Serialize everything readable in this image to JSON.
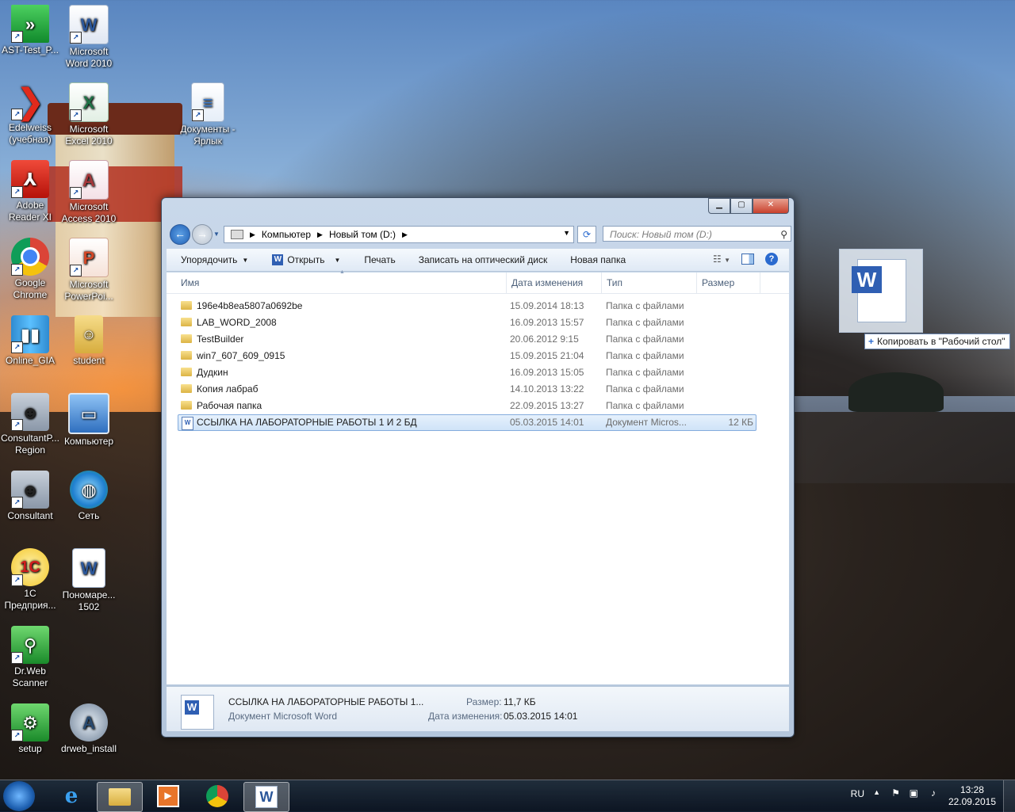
{
  "desktop_icons": [
    {
      "label": "AST-Test_P..."
    },
    {
      "label": "Microsoft Word 2010"
    },
    {
      "label": "Edelweiss (учебная)"
    },
    {
      "label": "Microsoft Excel 2010"
    },
    {
      "label": "Документы - Ярлык"
    },
    {
      "label": "Adobe Reader XI"
    },
    {
      "label": "Microsoft Access 2010"
    },
    {
      "label": "Google Chrome"
    },
    {
      "label": "Microsoft PowerPoi..."
    },
    {
      "label": "Online_GIA"
    },
    {
      "label": "student"
    },
    {
      "label": "ConsultantP... Region"
    },
    {
      "label": "Компьютер"
    },
    {
      "label": "Consultant"
    },
    {
      "label": "Сеть"
    },
    {
      "label": "1С Предприя..."
    },
    {
      "label": "Пономаре... 1502"
    },
    {
      "label": "Dr.Web Scanner"
    },
    {
      "label": "setup"
    },
    {
      "label": "drweb_install"
    }
  ],
  "window": {
    "breadcrumb": [
      "Компьютер",
      "Новый том (D:)"
    ],
    "search_placeholder": "Поиск: Новый том (D:)",
    "toolbar": {
      "organize": "Упорядочить",
      "open": "Открыть",
      "print": "Печать",
      "burn": "Записать на оптический диск",
      "new_folder": "Новая папка"
    },
    "columns": {
      "name": "Имя",
      "date": "Дата изменения",
      "type": "Тип",
      "size": "Размер"
    },
    "files": [
      {
        "name": "196e4b8ea5807a0692be",
        "date": "15.09.2014 18:13",
        "type": "Папка с файлами",
        "size": "",
        "kind": "folder"
      },
      {
        "name": "LAB_WORD_2008",
        "date": "16.09.2013 15:57",
        "type": "Папка с файлами",
        "size": "",
        "kind": "folder"
      },
      {
        "name": "TestBuilder",
        "date": "20.06.2012 9:15",
        "type": "Папка с файлами",
        "size": "",
        "kind": "folder"
      },
      {
        "name": "win7_607_609_0915",
        "date": "15.09.2015 21:04",
        "type": "Папка с файлами",
        "size": "",
        "kind": "folder"
      },
      {
        "name": "Дудкин",
        "date": "16.09.2013 15:05",
        "type": "Папка с файлами",
        "size": "",
        "kind": "folder"
      },
      {
        "name": "Копия лабраб",
        "date": "14.10.2013 13:22",
        "type": "Папка с файлами",
        "size": "",
        "kind": "folder"
      },
      {
        "name": "Рабочая папка",
        "date": "22.09.2015 13:27",
        "type": "Папка с файлами",
        "size": "",
        "kind": "folder"
      },
      {
        "name": "ССЫЛКА НА ЛАБОРАТОРНЫЕ РАБОТЫ 1 И 2 БД",
        "date": "05.03.2015 14:01",
        "type": "Документ Micros...",
        "size": "12 КБ",
        "kind": "doc",
        "selected": true
      }
    ],
    "details": {
      "name": "ССЫЛКА НА ЛАБОРАТОРНЫЕ РАБОТЫ 1...",
      "type": "Документ Microsoft Word",
      "size_label": "Размер:",
      "size_value": "11,7 КБ",
      "date_label": "Дата изменения:",
      "date_value": "05.03.2015 14:01"
    }
  },
  "drag": {
    "tooltip": "Копировать в \"Рабочий стол\""
  },
  "taskbar": {
    "language": "RU",
    "time": "13:28",
    "date": "22.09.2015"
  }
}
